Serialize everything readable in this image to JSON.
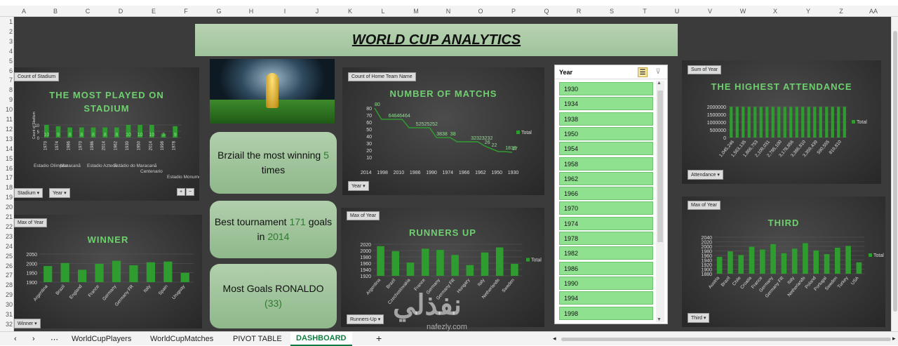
{
  "columns": [
    "A",
    "B",
    "C",
    "D",
    "E",
    "F",
    "G",
    "H",
    "I",
    "J",
    "K",
    "L",
    "M",
    "N",
    "O",
    "P",
    "Q",
    "R",
    "S",
    "T",
    "U",
    "V",
    "W",
    "X",
    "Y",
    "Z",
    "AA"
  ],
  "rows": [
    "1",
    "2",
    "3",
    "4",
    "5",
    "6",
    "7",
    "8",
    "9",
    "10",
    "11",
    "12",
    "13",
    "14",
    "15",
    "16",
    "17",
    "18",
    "19",
    "20",
    "21",
    "22",
    "23",
    "24",
    "25",
    "26",
    "27",
    "28",
    "29",
    "30",
    "31",
    "32"
  ],
  "dashboard_title": "WORLD CUP ANALYTICS",
  "cards": [
    {
      "pre": "Brziail the most winning ",
      "hl": "5",
      "post": " times"
    },
    {
      "pre": "Best tournament ",
      "hl": "171",
      "mid": " goals in ",
      "hl2": "2014"
    },
    {
      "pre": "Most Goals RONALDO ",
      "hl": "(33)"
    }
  ],
  "stadium": {
    "chip": "Count of Stadium",
    "title": "THE MOST PLAYED ON STADIUM",
    "filter1": "Stadium",
    "filter2": "Year",
    "ylabel": "Count of Stadium",
    "yticks": [
      "10",
      "5",
      "0"
    ],
    "categories": [
      "1970",
      "1974",
      "1986",
      "1970",
      "1986",
      "2014",
      "1962",
      "1930",
      "1950",
      "2014",
      "1998",
      "1978"
    ],
    "values": [
      10,
      9,
      8,
      8,
      8,
      8,
      8,
      10,
      10,
      10,
      3,
      9
    ],
    "x_text": [
      "Estadio Olímpico",
      "Maracanã",
      "Estadio Azteca",
      "Estádio do Maracanã",
      "Centenario",
      "Estadio Monumental"
    ]
  },
  "matchs": {
    "chip": "Count of Home Team Name",
    "title": "NUMBER OF MATCHS",
    "filter": "Year",
    "legend": "Total",
    "yticks": [
      "80",
      "70",
      "60",
      "50",
      "40",
      "30",
      "20",
      "10"
    ],
    "categories": [
      "2014",
      "1998",
      "2010",
      "1986",
      "1990",
      "1974",
      "1966",
      "1962",
      "1950",
      "1930"
    ],
    "labels": [
      "80",
      "64646464",
      "52525252",
      "3838",
      "38",
      "32323232",
      "26",
      "22",
      "1818",
      "17"
    ],
    "values": [
      80,
      64,
      64,
      64,
      64,
      52,
      52,
      52,
      52,
      38,
      38,
      38,
      32,
      32,
      32,
      32,
      26,
      22,
      18,
      18,
      17
    ]
  },
  "winner": {
    "chip": "Max of Year",
    "title": "WINNER",
    "filter": "Winner",
    "yticks": [
      "2050",
      "2000",
      "1950",
      "1900"
    ],
    "categories": [
      "Argentina",
      "Brazil",
      "England",
      "France",
      "Germany",
      "Germany FR",
      "Italy",
      "Spain",
      "Uruguay"
    ],
    "values": [
      1986,
      2002,
      1966,
      1998,
      2014,
      1990,
      2006,
      2010,
      1950
    ]
  },
  "runners": {
    "chip": "Max of Year",
    "title": "RUNNERS UP",
    "filter": "Runners-Up",
    "legend": "Total",
    "yticks": [
      "2020",
      "2000",
      "1980",
      "1960",
      "1940",
      "1920"
    ],
    "categories": [
      "Argentina",
      "Brazil",
      "Czechoslovakia",
      "France",
      "Germany",
      "Germany FR",
      "Hungary",
      "Italy",
      "Netherlands",
      "Sweden"
    ],
    "values": [
      2014,
      1998,
      1962,
      2006,
      2002,
      1986,
      1954,
      1994,
      2010,
      1958
    ]
  },
  "slicer": {
    "title": "Year",
    "years": [
      "1930",
      "1934",
      "1938",
      "1950",
      "1954",
      "1958",
      "1962",
      "1966",
      "1970",
      "1974",
      "1978",
      "1982",
      "1986",
      "1990",
      "1994",
      "1998"
    ]
  },
  "attendance": {
    "chip": "Sum of Year",
    "title": "THE HIGHEST ATTENDANCE",
    "filter": "Attendance",
    "legend": "Total",
    "yticks": [
      "2000000",
      "1500000",
      "1000000",
      "500000",
      "0"
    ],
    "categories": [
      "1,045,246",
      "1,563,135",
      "1,866,753",
      "2,109,031",
      "2,785,100",
      "3,178,856",
      "3,386,810",
      "3,359,439",
      "590,555",
      "819,810"
    ],
    "values": [
      1990000,
      1990000,
      1990000,
      1990000,
      1990000,
      1990000,
      1990000,
      1990000,
      1990000,
      1990000,
      1990000,
      1990000,
      1990000,
      1990000,
      1990000,
      1990000,
      1990000,
      1990000,
      1990000,
      1990000
    ]
  },
  "third": {
    "chip": "Max of Year",
    "title": "THIRD",
    "filter": "Third",
    "legend": "Total",
    "yticks": [
      "2040",
      "2020",
      "2000",
      "1980",
      "1960",
      "1940",
      "1920",
      "1900",
      "1880"
    ],
    "categories": [
      "Austria",
      "Brazil",
      "Chile",
      "Croatia",
      "France",
      "Germany",
      "Germany FR",
      "Italy",
      "Netherlands",
      "Poland",
      "Portugal",
      "Sweden",
      "Turkey",
      "USA"
    ],
    "values": [
      1954,
      1978,
      1962,
      1998,
      1986,
      2010,
      1970,
      1990,
      2014,
      1982,
      1966,
      1994,
      2002,
      1930
    ]
  },
  "tabs": [
    "WorldCupPlayers",
    "WorldCupMatches",
    "PIVOT TABLE",
    "DASHBOARD"
  ],
  "watermark": "نفذلي",
  "watermark_url": "nafezly.com",
  "colors": {
    "bar": "#2e9c2e",
    "accent": "#6fd06f",
    "slicer_item": "#8fe08f",
    "title_bg": "#a9cba4"
  }
}
